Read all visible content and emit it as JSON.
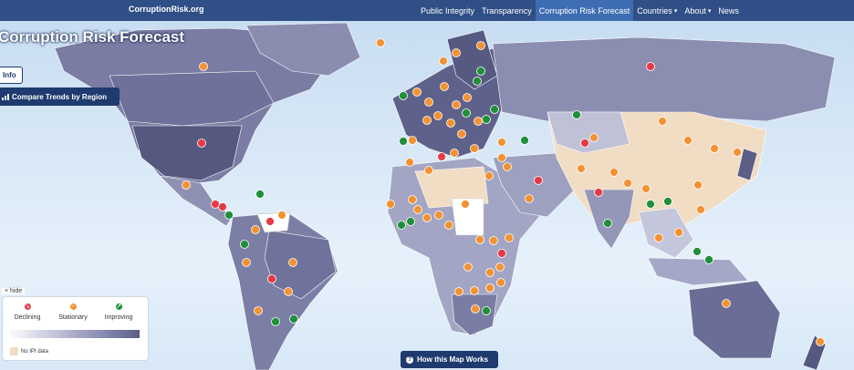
{
  "brand": "CorruptionRisk.org",
  "nav": [
    {
      "label": "Public Integrity",
      "active": false,
      "dropdown": false
    },
    {
      "label": "Transparency",
      "active": false,
      "dropdown": false
    },
    {
      "label": "Corruption Risk Forecast",
      "active": true,
      "dropdown": false
    },
    {
      "label": "Countries",
      "active": false,
      "dropdown": true
    },
    {
      "label": "About",
      "active": false,
      "dropdown": true
    },
    {
      "label": "News",
      "active": false,
      "dropdown": false
    }
  ],
  "title": "Corruption Risk Forecast",
  "info_button": "Info",
  "compare_button": "Compare Trends by Region",
  "legend": {
    "hide_label": "× hide",
    "declining": "Declining",
    "stationary": "Stationary",
    "improving": "Improving",
    "no_data": "No IPI data"
  },
  "how_button": "How this Map Works",
  "colors": {
    "navbar": "#2f4f86",
    "declining": "#e63946",
    "stationary": "#f39233",
    "improving": "#1f8f3a",
    "no_data": "#f1dcc4"
  }
}
